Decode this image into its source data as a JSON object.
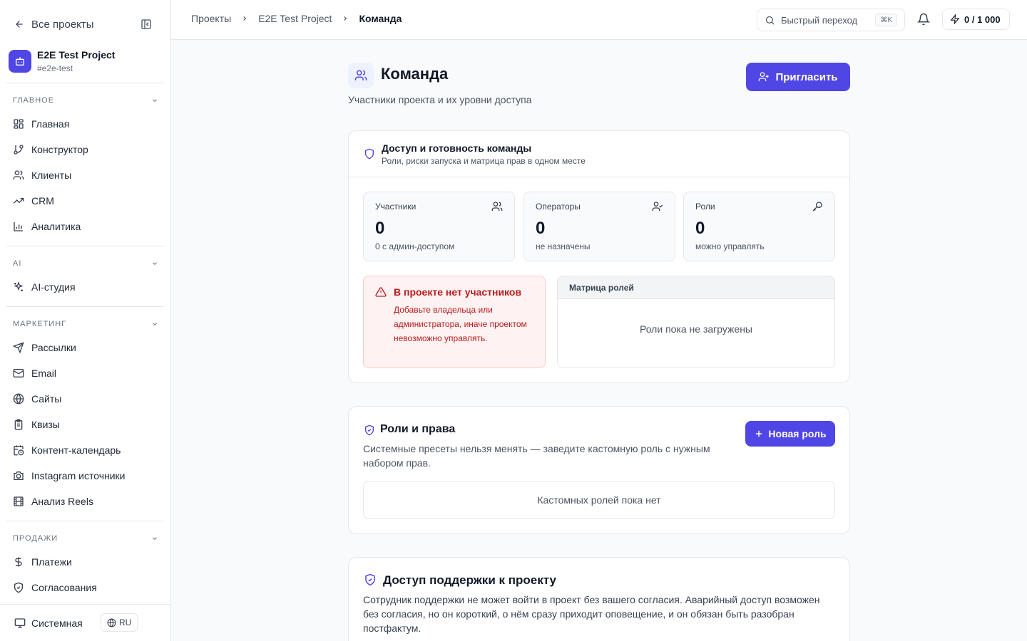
{
  "sidebar": {
    "back_label": "Все проекты",
    "project": {
      "name": "E2E Test Project",
      "slug": "#e2e-test"
    },
    "sections": [
      {
        "title": "Главное",
        "items": [
          "Главная",
          "Конструктор",
          "Клиенты",
          "CRM",
          "Аналитика"
        ]
      },
      {
        "title": "AI",
        "items": [
          "AI-студия"
        ]
      },
      {
        "title": "Маркетинг",
        "items": [
          "Рассылки",
          "Email",
          "Сайты",
          "Квизы",
          "Контент-календарь",
          "Instagram источники",
          "Анализ Reels"
        ]
      },
      {
        "title": "Продажи",
        "items": [
          "Платежи",
          "Согласования"
        ]
      }
    ],
    "theme_label": "Системная",
    "lang_label": "RU"
  },
  "topbar": {
    "breadcrumbs": [
      "Проекты",
      "E2E Test Project",
      "Команда"
    ],
    "quick_jump": {
      "label": "Быстрый переход",
      "shortcut": "⌘K"
    },
    "quota": "0 / 1 000"
  },
  "page": {
    "title": "Команда",
    "subtitle": "Участники проекта и их уровни доступа",
    "invite_label": "Пригласить"
  },
  "access": {
    "title": "Доступ и готовность команды",
    "subtitle": "Роли, риски запуска и матрица прав в одном месте",
    "stats": [
      {
        "label": "Участники",
        "value": "0",
        "note": "0 с админ-доступом"
      },
      {
        "label": "Операторы",
        "value": "0",
        "note": "не назначены"
      },
      {
        "label": "Роли",
        "value": "0",
        "note": "можно управлять"
      }
    ],
    "alert": {
      "title": "В проекте нет участников",
      "text": "Добавьте владельца или администратора, иначе проектом невозможно управлять."
    },
    "matrix": {
      "title": "Матрица ролей",
      "empty": "Роли пока не загружены"
    }
  },
  "roles": {
    "title": "Роли и права",
    "subtitle": "Системные пресеты нельзя менять — заведите кастомную роль с нужным набором прав.",
    "new_role_label": "Новая роль",
    "empty": "Кастомных ролей пока нет"
  },
  "support": {
    "title": "Доступ поддержки к проекту",
    "text": "Сотрудник поддержки не может войти в проект без вашего согласия. Аварийный доступ возможен без согласия, но он короткий, о нём сразу приходит оповещение, и он обязан быть разобран постфактум."
  },
  "colors": {
    "accent": "#4f46e5",
    "danger": "#b91c1c",
    "danger_bg": "#fef2f2"
  }
}
